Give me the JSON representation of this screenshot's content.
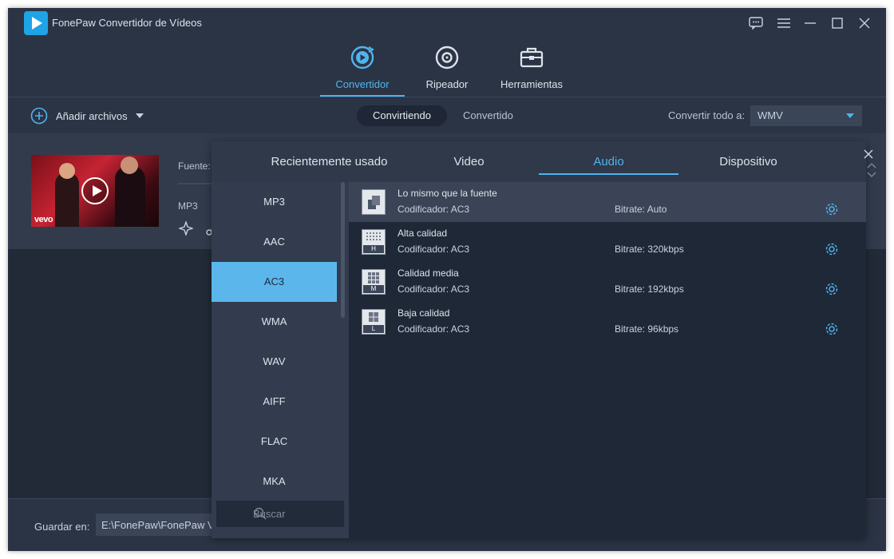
{
  "window": {
    "title": "FonePaw Convertidor de Vídeos"
  },
  "nav": {
    "tabs": [
      {
        "label": "Convertidor",
        "icon": "convert-icon",
        "active": true
      },
      {
        "label": "Ripeador",
        "icon": "disc-icon",
        "active": false
      },
      {
        "label": "Herramientas",
        "icon": "toolbox-icon",
        "active": false
      }
    ]
  },
  "toolbar": {
    "add_files": "Añadir archivos",
    "status_tabs": [
      "Convirtiendo",
      "Convertido"
    ],
    "convert_all_label": "Convertir todo a:",
    "convert_all_value": "WMV"
  },
  "file": {
    "source_label": "Fuente:",
    "format": "MP3",
    "thumbnail_logo": "vevo"
  },
  "bottom": {
    "save_label": "Guardar en:",
    "save_path": "E:\\FonePaw\\FonePaw V"
  },
  "popup": {
    "tabs": [
      "Recientemente usado",
      "Video",
      "Audio",
      "Dispositivo"
    ],
    "active_tab": "Audio",
    "formats": [
      "MP3",
      "AAC",
      "AC3",
      "WMA",
      "WAV",
      "AIFF",
      "FLAC",
      "MKA"
    ],
    "selected_format": "AC3",
    "search_placeholder": "Buscar",
    "presets": [
      {
        "name": "Lo mismo que la fuente",
        "encoder": "Codificador: AC3",
        "bitrate": "Bitrate: Auto",
        "badge": ""
      },
      {
        "name": "Alta calidad",
        "encoder": "Codificador: AC3",
        "bitrate": "Bitrate: 320kbps",
        "badge": "H"
      },
      {
        "name": "Calidad media",
        "encoder": "Codificador: AC3",
        "bitrate": "Bitrate: 192kbps",
        "badge": "M"
      },
      {
        "name": "Baja calidad",
        "encoder": "Codificador: AC3",
        "bitrate": "Bitrate: 96kbps",
        "badge": "L"
      }
    ]
  },
  "colors": {
    "accent": "#4fb4ee",
    "background": "#2b3445",
    "selected": "#5bb6ec"
  }
}
